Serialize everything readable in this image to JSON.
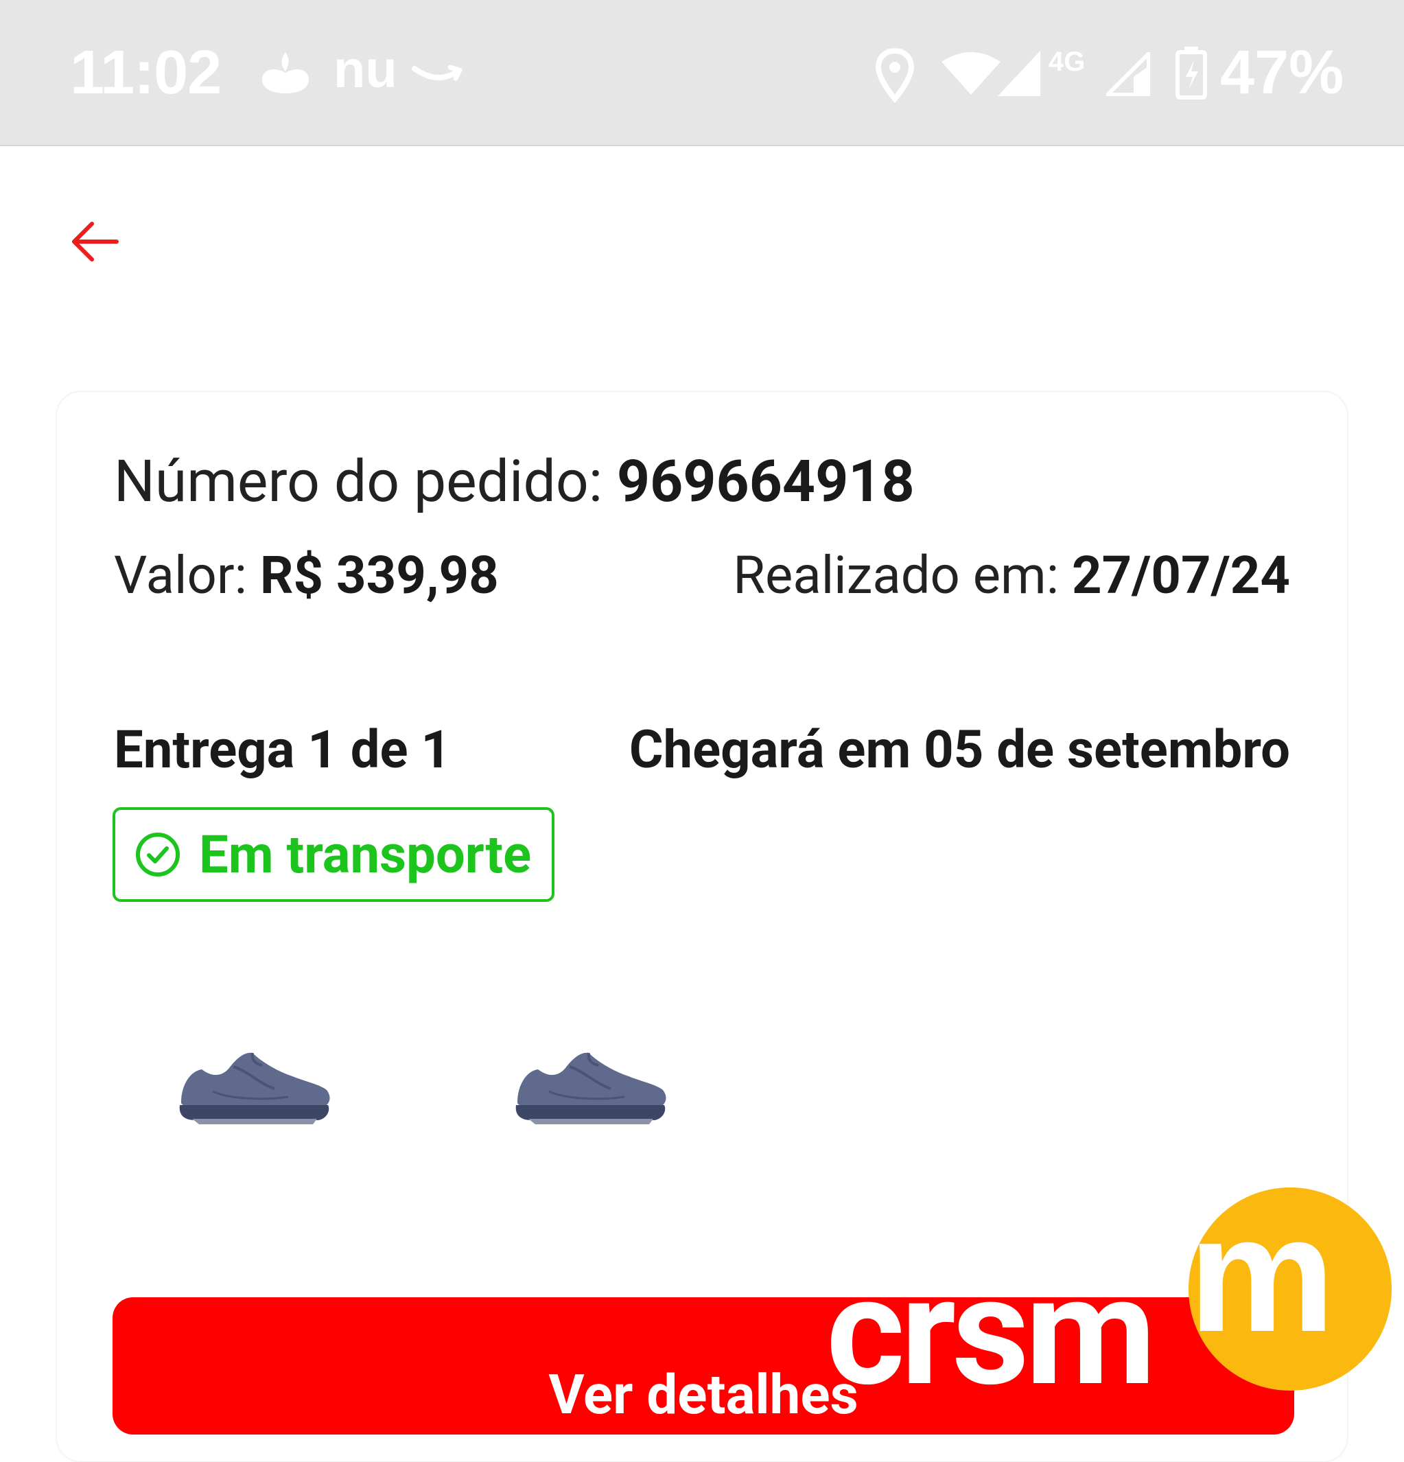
{
  "status_bar": {
    "time": "11:02",
    "nu_label": "nu",
    "network": "4G",
    "battery_percent": "47%"
  },
  "order": {
    "number_label": "Número do pedido: ",
    "number_value": "969664918",
    "value_label": "Valor: ",
    "value_value": "R$ 339,98",
    "date_label": "Realizado em: ",
    "date_value": "27/07/24"
  },
  "delivery": {
    "label": "Entrega 1 de 1",
    "eta": "Chegará em 05 de setembro",
    "status": "Em transporte"
  },
  "products": [
    {
      "icon": "sneaker-image"
    },
    {
      "icon": "sneaker-image"
    }
  ],
  "actions": {
    "details_label": "Ver detalhes",
    "overlay_word": "crsm"
  },
  "chat_bubble": {
    "letter": "m"
  },
  "colors": {
    "accent_red": "#fe0000",
    "status_green": "#1ec41e",
    "bubble_yellow": "#fbb910",
    "status_bar_bg": "#e6e6e6"
  }
}
